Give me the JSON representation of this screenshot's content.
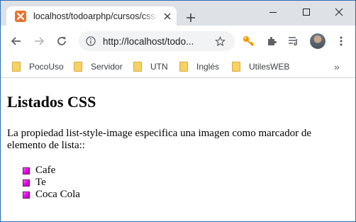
{
  "browser": {
    "tab": {
      "title": "localhost/todoarphp/cursos/css/d"
    },
    "toolbar": {
      "url": "http://localhost/todo..."
    },
    "bookmarks": [
      {
        "label": "PocoUso"
      },
      {
        "label": "Servidor"
      },
      {
        "label": "UTN"
      },
      {
        "label": "Inglés"
      },
      {
        "label": "UtilesWEB"
      }
    ],
    "bookmarks_overflow": "»",
    "colors": {
      "tabstrip": "#dee1e6",
      "omnibox": "#f1f3f4",
      "favicon": "#e8722a",
      "key_icon": "#f29900"
    }
  },
  "page": {
    "heading": "Listados CSS",
    "paragraph": "La propiedad list-style-image especifica una imagen como marcador de elemento de lista::",
    "list_items": [
      "Cafe",
      "Te",
      "Coca Cola"
    ],
    "marker_color": "#e100e1"
  }
}
